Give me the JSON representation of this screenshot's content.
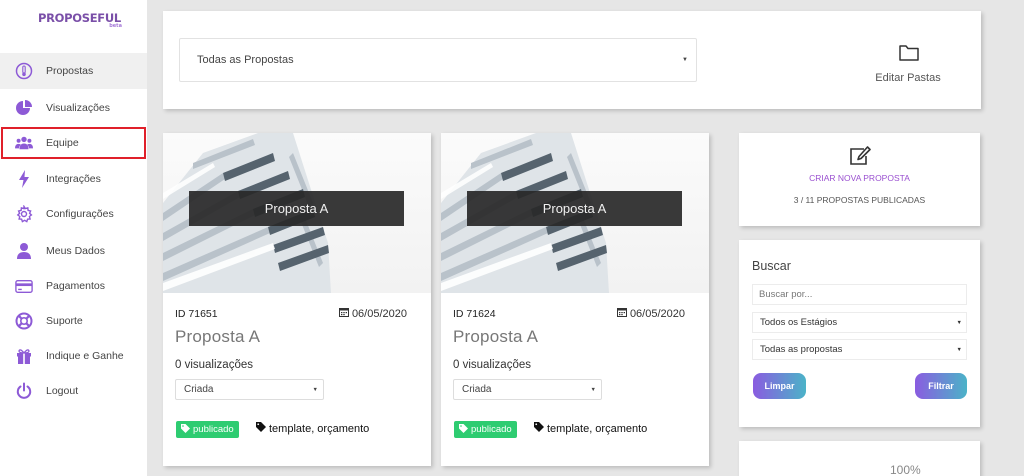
{
  "brand": {
    "name": "PROPOSEFUL",
    "sub": "beta"
  },
  "sidebar": {
    "items": [
      {
        "label": "Propostas",
        "icon": "thermometer-icon",
        "active": true
      },
      {
        "label": "Visualizações",
        "icon": "pie-chart-icon"
      },
      {
        "label": "Equipe",
        "icon": "users-icon"
      },
      {
        "label": "Integrações",
        "icon": "bolt-icon"
      },
      {
        "label": "Configurações",
        "icon": "gear-icon"
      },
      {
        "label": "Meus Dados",
        "icon": "user-icon"
      },
      {
        "label": "Pagamentos",
        "icon": "credit-card-icon"
      },
      {
        "label": "Suporte",
        "icon": "life-ring-icon"
      },
      {
        "label": "Indique e Ganhe",
        "icon": "gift-icon"
      },
      {
        "label": "Logout",
        "icon": "power-icon"
      }
    ]
  },
  "header": {
    "proposal_filter": "Todas as Propostas",
    "edit_folders_label": "Editar Pastas"
  },
  "proposals": [
    {
      "banner": "Proposta A",
      "id": "ID 71651",
      "date": "06/05/2020",
      "title": "Proposta A",
      "views": "0 visualizações",
      "stage": "Criada",
      "badge": "publicado",
      "tags": "template, orçamento"
    },
    {
      "banner": "Proposta A",
      "id": "ID 71624",
      "date": "06/05/2020",
      "title": "Proposta A",
      "views": "0 visualizações",
      "stage": "Criada",
      "badge": "publicado",
      "tags": "template, orçamento"
    }
  ],
  "create": {
    "cta": "CRIAR NOVA PROPOSTA",
    "count": "3 / 11 PROPOSTAS PUBLICADAS"
  },
  "search": {
    "title": "Buscar",
    "placeholder": "Buscar por...",
    "stage_filter": "Todos os Estágios",
    "proposal_filter": "Todas as propostas",
    "clear_label": "Limpar",
    "filter_label": "Filtrar"
  },
  "usage": {
    "percent_label": "100%"
  },
  "colors": {
    "accent": "#9a50d0",
    "published": "#2ecc71",
    "highlight": "#e0202a"
  }
}
